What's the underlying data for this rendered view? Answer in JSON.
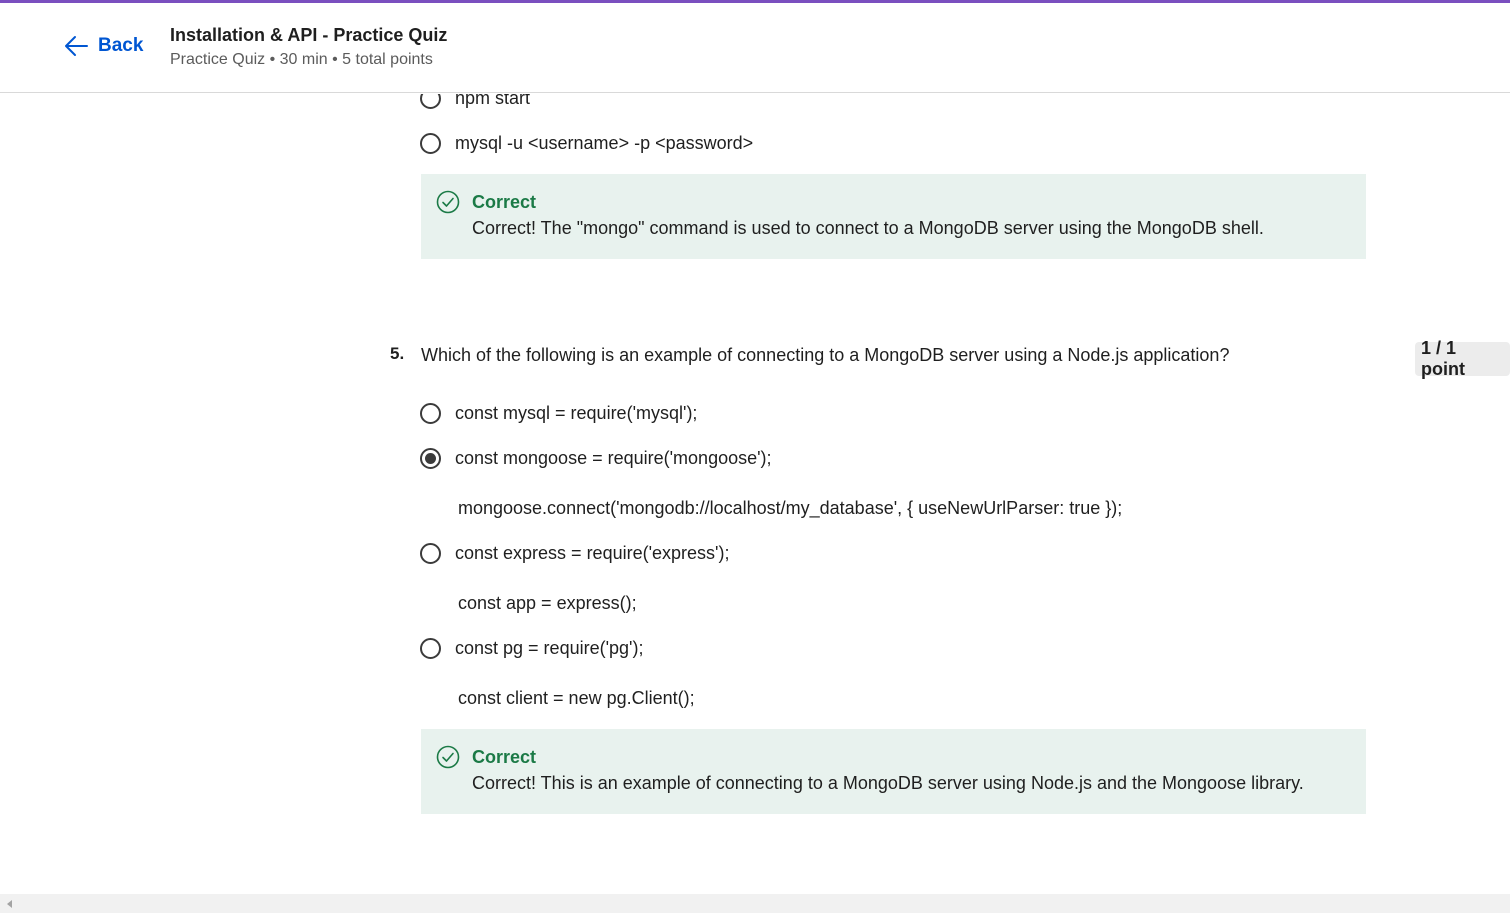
{
  "header": {
    "back_label": "Back",
    "title": "Installation & API - Practice Quiz",
    "meta": "Practice Quiz • 30 min • 5 total points"
  },
  "question4": {
    "options": [
      "npm start",
      "mysql -u <username> -p <password>"
    ],
    "feedback": {
      "title": "Correct",
      "text": "Correct! The \"mongo\" command is used to connect to a MongoDB server using the MongoDB shell."
    }
  },
  "question5": {
    "number": "5.",
    "text": "Which of the following is an example of connecting to a MongoDB server using a Node.js application?",
    "points": "1 / 1 point",
    "options": [
      {
        "line1": "const mysql = require('mysql');",
        "line2": "",
        "selected": false
      },
      {
        "line1": "const mongoose = require('mongoose');",
        "line2": "mongoose.connect('mongodb://localhost/my_database', { useNewUrlParser: true });",
        "selected": true
      },
      {
        "line1": "const express = require('express');",
        "line2": "const app = express();",
        "selected": false
      },
      {
        "line1": "const pg = require('pg');",
        "line2": "const client = new pg.Client();",
        "selected": false
      }
    ],
    "feedback": {
      "title": "Correct",
      "text": "Correct! This is an example of connecting to a MongoDB server using Node.js and the Mongoose library."
    }
  },
  "colors": {
    "accent": "#0056d2",
    "success": "#1b7a46",
    "feedback_bg": "#e8f2ee",
    "top_border": "#7a4fbf"
  },
  "icons": {
    "back": "arrow-left-icon",
    "feedback": "check-circle-icon"
  }
}
